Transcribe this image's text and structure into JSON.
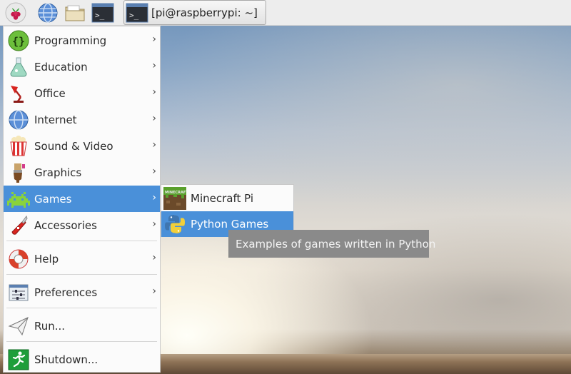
{
  "taskbar": {
    "launchers": [
      {
        "icon": "raspberry-menu-icon"
      },
      {
        "icon": "web-browser-icon"
      },
      {
        "icon": "file-manager-icon"
      },
      {
        "icon": "terminal-icon"
      }
    ],
    "task": {
      "icon": "terminal-icon",
      "label": "[pi@raspberrypi: ~]"
    }
  },
  "menu": {
    "items": [
      {
        "label": "Programming",
        "icon": "programming-icon",
        "submenu": true
      },
      {
        "label": "Education",
        "icon": "flask-icon",
        "submenu": true
      },
      {
        "label": "Office",
        "icon": "office-lamp-icon",
        "submenu": true
      },
      {
        "label": "Internet",
        "icon": "globe-icon",
        "submenu": true
      },
      {
        "label": "Sound & Video",
        "icon": "popcorn-icon",
        "submenu": true
      },
      {
        "label": "Graphics",
        "icon": "paintbrush-icon",
        "submenu": true
      },
      {
        "label": "Games",
        "icon": "space-invader-icon",
        "submenu": true,
        "active": true
      },
      {
        "label": "Accessories",
        "icon": "pocket-knife-icon",
        "submenu": true
      },
      {
        "label": "Help",
        "icon": "lifebuoy-icon",
        "submenu": true
      },
      {
        "label": "Preferences",
        "icon": "sliders-icon",
        "submenu": true
      },
      {
        "label": "Run...",
        "icon": "paper-plane-icon",
        "submenu": false
      },
      {
        "label": "Shutdown...",
        "icon": "exit-running-man-icon",
        "submenu": false
      }
    ],
    "arrow_glyph": "›"
  },
  "games_submenu": {
    "items": [
      {
        "label": "Minecraft Pi",
        "icon": "minecraft-icon"
      },
      {
        "label": "Python Games",
        "icon": "python-icon",
        "active": true
      }
    ]
  },
  "tooltip": {
    "text": "Examples of games written in Python"
  },
  "colors": {
    "highlight": "#4a90d9",
    "menu_bg": "#fbfbfb",
    "tooltip_bg": "#8a8a8a"
  }
}
